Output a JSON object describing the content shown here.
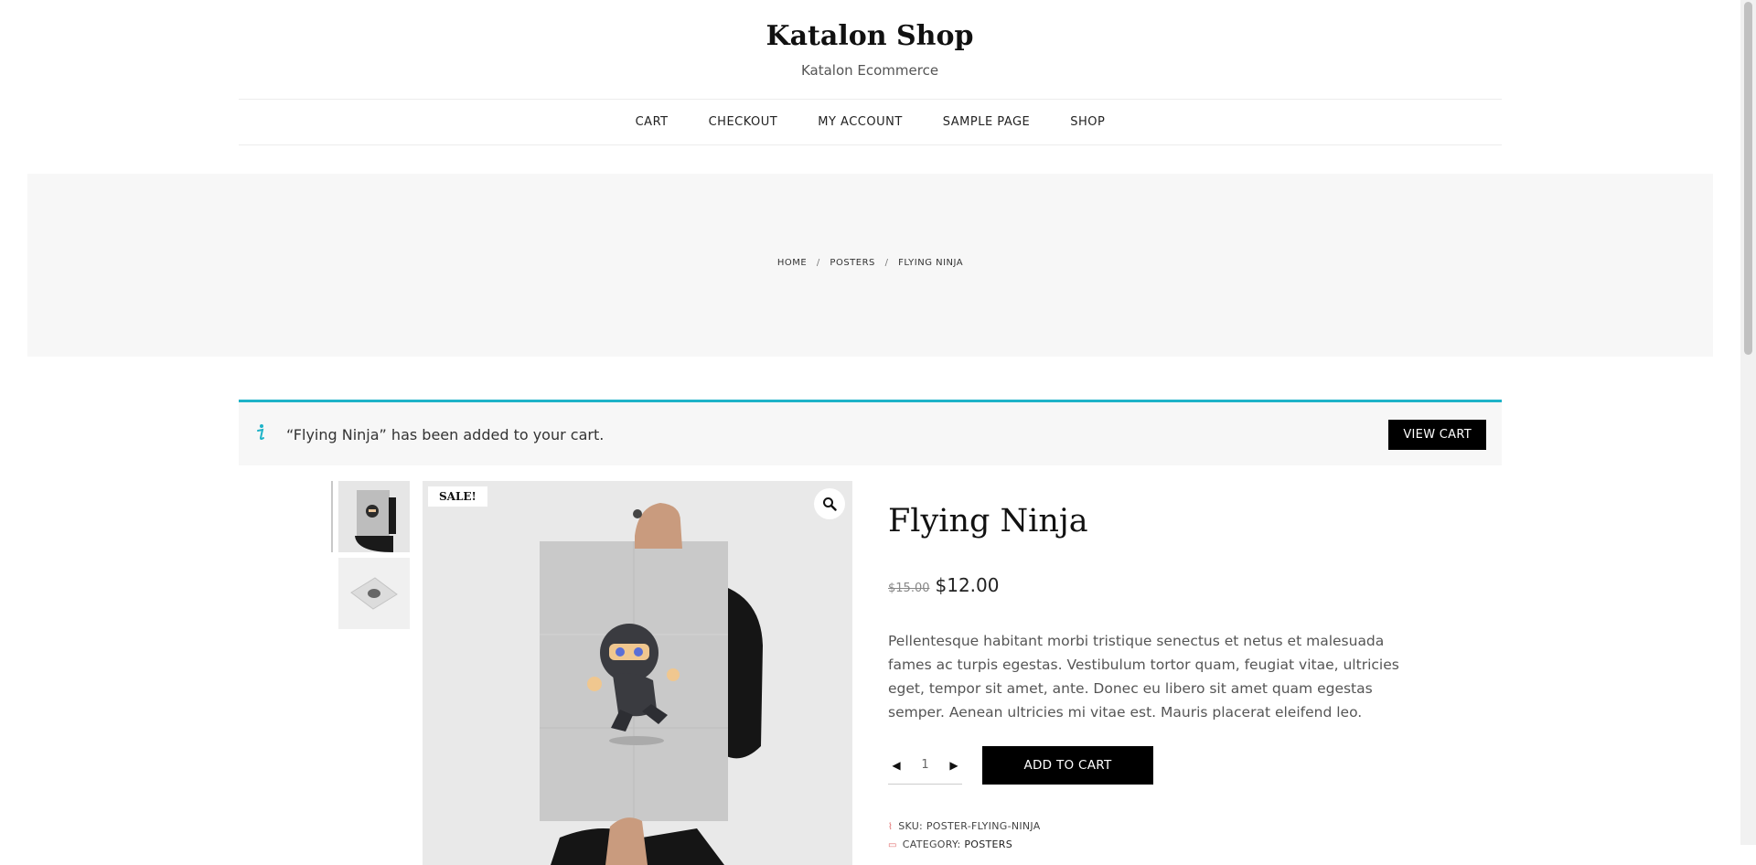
{
  "header": {
    "site_title": "Katalon Shop",
    "tagline": "Katalon Ecommerce"
  },
  "nav": {
    "items": [
      {
        "label": "CART"
      },
      {
        "label": "CHECKOUT"
      },
      {
        "label": "MY ACCOUNT"
      },
      {
        "label": "SAMPLE PAGE"
      },
      {
        "label": "SHOP"
      }
    ]
  },
  "breadcrumb": {
    "items": [
      "HOME",
      "POSTERS",
      "FLYING NINJA"
    ],
    "separator": "/"
  },
  "notice": {
    "message": "“Flying Ninja” has been added to your cart.",
    "button_label": "VIEW CART",
    "icon": "info-icon",
    "accent_color": "#1eb3c8"
  },
  "gallery": {
    "sale_badge": "SALE!",
    "zoom_icon": "search-icon",
    "thumbnails": [
      {
        "name": "thumbnail-poster-held"
      },
      {
        "name": "thumbnail-poster-flat"
      }
    ]
  },
  "product": {
    "title": "Flying Ninja",
    "old_price": "$15.00",
    "price": "$12.00",
    "description": "Pellentesque habitant morbi tristique senectus et netus et malesuada fames ac turpis egestas. Vestibulum tortor quam, feugiat vitae, ultricies eget, tempor sit amet, ante. Donec eu libero sit amet quam egestas semper. Aenean ultricies mi vitae est. Mauris placerat eleifend leo.",
    "quantity": "1",
    "add_to_cart_label": "ADD TO CART",
    "sku_label": "SKU:",
    "sku": "POSTER-FLYING-NINJA",
    "category_label": "CATEGORY:",
    "category": "POSTERS"
  },
  "colors": {
    "button_bg": "#000000",
    "banner_bg": "#f7f7f7"
  }
}
